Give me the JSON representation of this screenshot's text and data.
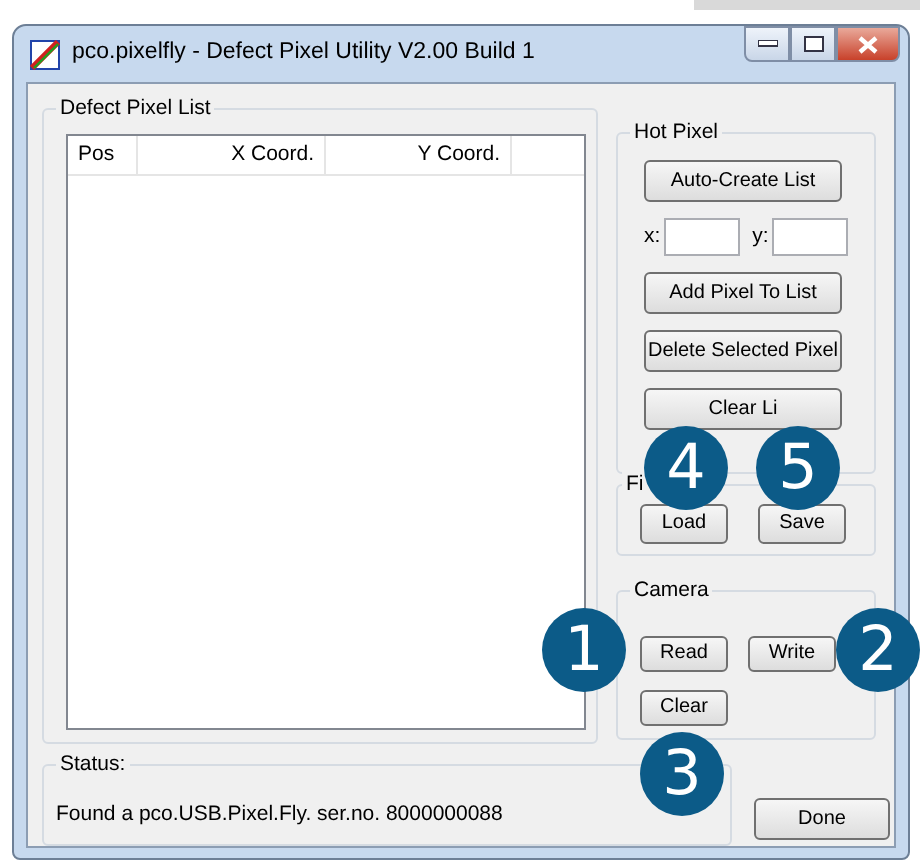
{
  "window": {
    "title": "pco.pixelfly - Defect Pixel Utility V2.00 Build 1"
  },
  "defect_pixel_list": {
    "label": "Defect Pixel List",
    "columns": [
      "Pos",
      "X Coord.",
      "Y Coord."
    ]
  },
  "hot_pixel": {
    "label": "Hot Pixel",
    "create_button": "Auto-Create List",
    "fields": [
      {
        "label": "x:"
      },
      {
        "label": "y:"
      }
    ],
    "buttons": [
      "Add Pixel To List",
      "Delete Selected Pixel",
      "Clear Li"
    ]
  },
  "file": {
    "label": "Fi",
    "buttons": [
      "Load",
      "Save"
    ]
  },
  "camera": {
    "label": "Camera",
    "buttons": [
      "Read",
      "Write",
      "Clear"
    ]
  },
  "status": {
    "label": "Status:",
    "text": "Found a pco.USB.Pixel.Fly. ser.no. 8000000088"
  },
  "done_button": "Done",
  "callouts": [
    "1",
    "2",
    "3",
    "4",
    "5"
  ]
}
